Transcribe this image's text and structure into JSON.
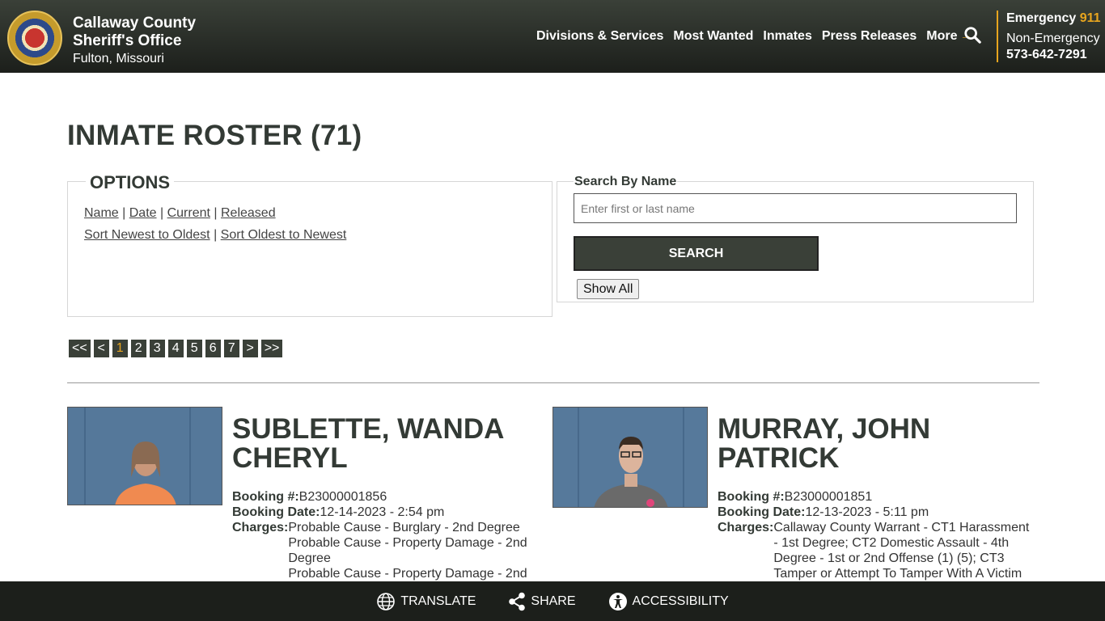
{
  "header": {
    "brand_line1": "Callaway County",
    "brand_line2": "Sheriff's Office",
    "brand_line3": "Fulton, Missouri",
    "nav": [
      "Divisions & Services",
      "Most Wanted",
      "Inmates",
      "Press Releases",
      "More"
    ],
    "emergency_label": "Emergency",
    "emergency_number": "911",
    "non_emergency_label": "Non-Emergency",
    "non_emergency_number": "573-642-7291"
  },
  "page": {
    "title": "INMATE ROSTER (71)"
  },
  "options": {
    "legend": "OPTIONS",
    "sort_links": [
      "Name",
      "Date",
      "Current",
      "Released"
    ],
    "order_links": [
      "Sort Newest to Oldest",
      "Sort Oldest to Newest"
    ]
  },
  "search": {
    "label": "Search By Name",
    "placeholder": "Enter first or last name",
    "button": "SEARCH",
    "show_all": "Show All"
  },
  "pager": [
    "<<",
    "<",
    "1",
    "2",
    "3",
    "4",
    "5",
    "6",
    "7",
    ">",
    ">>"
  ],
  "pager_active": "1",
  "inmates": [
    {
      "name": "SUBLETTE, WANDA CHERYL",
      "booking_label": "Booking #:",
      "booking_no": "B23000001856",
      "date_label": "Booking Date:",
      "date": "12-14-2023 - 2:54 pm",
      "charges_label": "Charges:",
      "charges": [
        "Probable Cause - Burglary - 2nd Degree",
        "Probable Cause - Property Damage - 2nd Degree",
        "Probable Cause - Property Damage - 2nd"
      ]
    },
    {
      "name": "MURRAY, JOHN PATRICK",
      "booking_label": "Booking #:",
      "booking_no": "B23000001851",
      "date_label": "Booking Date:",
      "date": "12-13-2023 - 5:11 pm",
      "charges_label": "Charges:",
      "charges": [
        "Callaway County Warrant - CT1 Harassment - 1st Degree; CT2 Domestic Assault - 4th Degree - 1st or 2nd Offense (1) (5); CT3 Tamper or Attempt To Tamper With A Victim"
      ]
    }
  ],
  "footer": {
    "translate": "TRANSLATE",
    "share": "SHARE",
    "accessibility": "ACCESSIBILITY"
  },
  "colors": {
    "header_bg": "#2c302a",
    "accent": "#e8a51e",
    "button_bg": "#3a4038"
  }
}
